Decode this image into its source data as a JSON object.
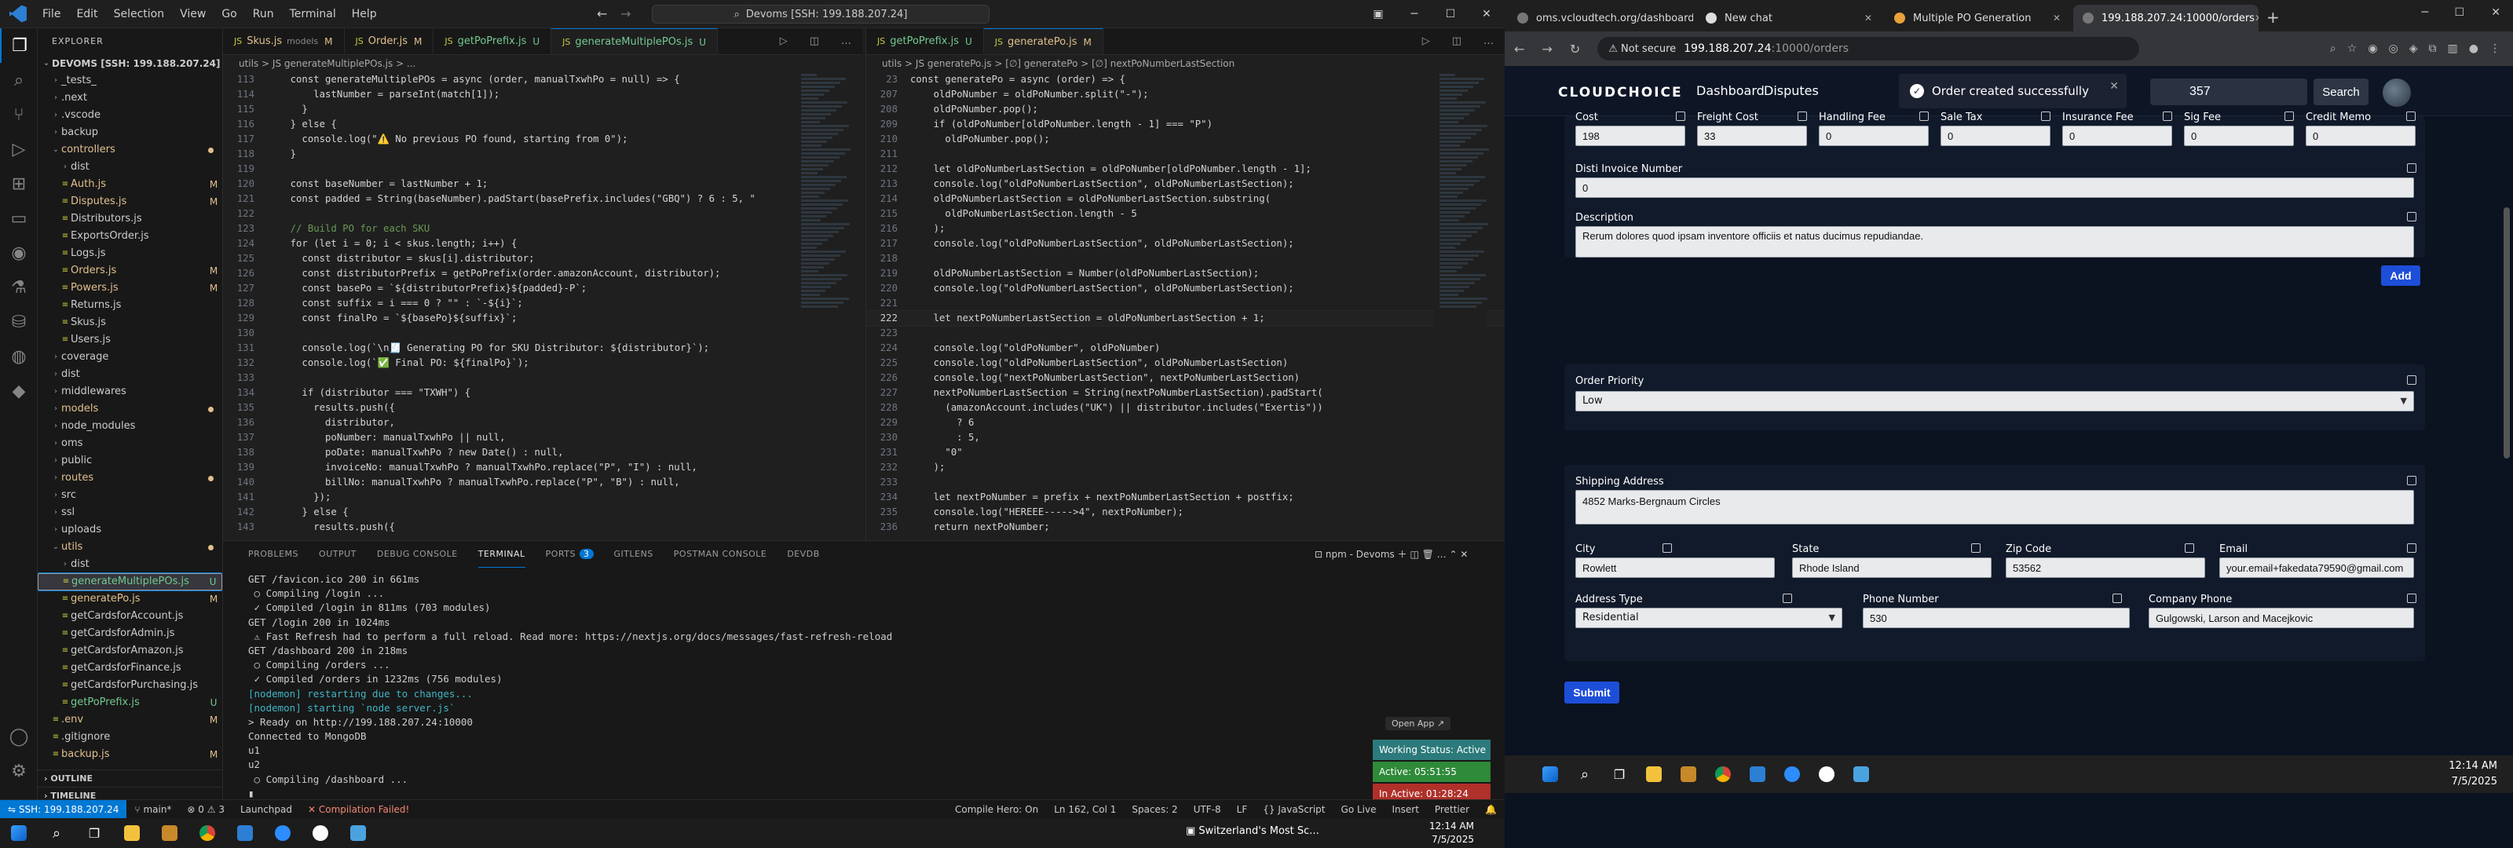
{
  "vscode": {
    "menu": [
      "File",
      "Edit",
      "Selection",
      "View",
      "Go",
      "Run",
      "Terminal",
      "Help"
    ],
    "command_center": "Devoms [SSH: 199.188.207.24]",
    "explorer_title": "EXPLORER",
    "root": "DEVOMS [SSH: 199.188.207.24]",
    "tree": [
      {
        "name": "_tests_",
        "indent": 1,
        "type": "folder",
        "open": false,
        "badge": ""
      },
      {
        "name": ".next",
        "indent": 1,
        "type": "folder",
        "open": false,
        "badge": ""
      },
      {
        "name": ".vscode",
        "indent": 1,
        "type": "folder",
        "open": false,
        "badge": ""
      },
      {
        "name": "backup",
        "indent": 1,
        "type": "folder",
        "open": false,
        "badge": ""
      },
      {
        "name": "controllers",
        "indent": 1,
        "type": "folder",
        "open": true,
        "badge": "",
        "color": "#e2c08d"
      },
      {
        "name": "dist",
        "indent": 2,
        "type": "folder",
        "open": false,
        "badge": ""
      },
      {
        "name": "Auth.js",
        "indent": 2,
        "type": "file",
        "badge": "M",
        "color": "#e2c08d"
      },
      {
        "name": "Disputes.js",
        "indent": 2,
        "type": "file",
        "badge": "M",
        "color": "#e2c08d"
      },
      {
        "name": "Distributors.js",
        "indent": 2,
        "type": "file",
        "badge": ""
      },
      {
        "name": "ExportsOrder.js",
        "indent": 2,
        "type": "file",
        "badge": ""
      },
      {
        "name": "Logs.js",
        "indent": 2,
        "type": "file",
        "badge": ""
      },
      {
        "name": "Orders.js",
        "indent": 2,
        "type": "file",
        "badge": "M",
        "color": "#e2c08d"
      },
      {
        "name": "Powers.js",
        "indent": 2,
        "type": "file",
        "badge": "M",
        "color": "#e2c08d"
      },
      {
        "name": "Returns.js",
        "indent": 2,
        "type": "file",
        "badge": ""
      },
      {
        "name": "Skus.js",
        "indent": 2,
        "type": "file",
        "badge": ""
      },
      {
        "name": "Users.js",
        "indent": 2,
        "type": "file",
        "badge": ""
      },
      {
        "name": "coverage",
        "indent": 1,
        "type": "folder",
        "open": false,
        "badge": ""
      },
      {
        "name": "dist",
        "indent": 1,
        "type": "folder",
        "open": false,
        "badge": ""
      },
      {
        "name": "middlewares",
        "indent": 1,
        "type": "folder",
        "open": false,
        "badge": ""
      },
      {
        "name": "models",
        "indent": 1,
        "type": "folder",
        "open": false,
        "badge": "",
        "color": "#e2c08d"
      },
      {
        "name": "node_modules",
        "indent": 1,
        "type": "folder",
        "open": false,
        "badge": ""
      },
      {
        "name": "oms",
        "indent": 1,
        "type": "folder",
        "open": false,
        "badge": ""
      },
      {
        "name": "public",
        "indent": 1,
        "type": "folder",
        "open": false,
        "badge": ""
      },
      {
        "name": "routes",
        "indent": 1,
        "type": "folder",
        "open": false,
        "badge": "",
        "color": "#e2c08d"
      },
      {
        "name": "src",
        "indent": 1,
        "type": "folder",
        "open": false,
        "badge": ""
      },
      {
        "name": "ssl",
        "indent": 1,
        "type": "folder",
        "open": false,
        "badge": ""
      },
      {
        "name": "uploads",
        "indent": 1,
        "type": "folder",
        "open": false,
        "badge": ""
      },
      {
        "name": "utils",
        "indent": 1,
        "type": "folder",
        "open": true,
        "badge": "",
        "color": "#e2c08d"
      },
      {
        "name": "dist",
        "indent": 2,
        "type": "folder",
        "open": false,
        "badge": ""
      },
      {
        "name": "generateMultiplePOs.js",
        "indent": 2,
        "type": "file",
        "badge": "U",
        "color": "#73c991",
        "selected": true
      },
      {
        "name": "generatePo.js",
        "indent": 2,
        "type": "file",
        "badge": "M",
        "color": "#e2c08d"
      },
      {
        "name": "getCardsforAccount.js",
        "indent": 2,
        "type": "file",
        "badge": ""
      },
      {
        "name": "getCardsforAdmin.js",
        "indent": 2,
        "type": "file",
        "badge": ""
      },
      {
        "name": "getCardsforAmazon.js",
        "indent": 2,
        "type": "file",
        "badge": ""
      },
      {
        "name": "getCardsforFinance.js",
        "indent": 2,
        "type": "file",
        "badge": ""
      },
      {
        "name": "getCardsforPurchasing.js",
        "indent": 2,
        "type": "file",
        "badge": ""
      },
      {
        "name": "getPoPrefix.js",
        "indent": 2,
        "type": "file",
        "badge": "U",
        "color": "#73c991"
      },
      {
        "name": ".env",
        "indent": 1,
        "type": "file",
        "badge": "M",
        "color": "#e2c08d"
      },
      {
        "name": ".gitignore",
        "indent": 1,
        "type": "file",
        "badge": ""
      },
      {
        "name": "backup.js",
        "indent": 1,
        "type": "file",
        "badge": "M",
        "color": "#e2c08d"
      }
    ],
    "outline": "OUTLINE",
    "timeline": "TIMELINE",
    "editor1": {
      "tabs": [
        {
          "label": "Skus.js",
          "sub": "models",
          "mark": "M",
          "active": false
        },
        {
          "label": "Order.js",
          "sub": "",
          "mark": "M",
          "active": false
        },
        {
          "label": "getPoPrefix.js",
          "sub": "",
          "mark": "U",
          "active": false
        },
        {
          "label": "generateMultiplePOs.js",
          "sub": "",
          "mark": "U",
          "active": true
        }
      ],
      "breadcrumb": "utils > JS generateMultiplePOs.js > ...",
      "lines": [
        {
          "n": "113",
          "t": "    const generateMultiplePOs = async (order, manualTxwhPo = null) => {"
        },
        {
          "n": "114",
          "t": "        lastNumber = parseInt(match[1]);"
        },
        {
          "n": "115",
          "t": "      }"
        },
        {
          "n": "116",
          "t": "    } else {"
        },
        {
          "n": "117",
          "t": "      console.log(\"⚠️ No previous PO found, starting from 0\");"
        },
        {
          "n": "118",
          "t": "    }"
        },
        {
          "n": "119",
          "t": ""
        },
        {
          "n": "120",
          "t": "    const baseNumber = lastNumber + 1;"
        },
        {
          "n": "121",
          "t": "    const padded = String(baseNumber).padStart(basePrefix.includes(\"GBQ\") ? 6 : 5, \""
        },
        {
          "n": "122",
          "t": ""
        },
        {
          "n": "123",
          "t": "    // Build PO for each SKU"
        },
        {
          "n": "124",
          "t": "    for (let i = 0; i < skus.length; i++) {"
        },
        {
          "n": "125",
          "t": "      const distributor = skus[i].distributor;"
        },
        {
          "n": "126",
          "t": "      const distributorPrefix = getPoPrefix(order.amazonAccount, distributor);"
        },
        {
          "n": "127",
          "t": "      const basePo = `${distributorPrefix}${padded}-P`;"
        },
        {
          "n": "128",
          "t": "      const suffix = i === 0 ? \"\" : `-${i}`;"
        },
        {
          "n": "129",
          "t": "      const finalPo = `${basePo}${suffix}`;"
        },
        {
          "n": "130",
          "t": ""
        },
        {
          "n": "131",
          "t": "      console.log(`\\n🧾 Generating PO for SKU Distributor: ${distributor}`);"
        },
        {
          "n": "132",
          "t": "      console.log(`✅ Final PO: ${finalPo}`);"
        },
        {
          "n": "133",
          "t": ""
        },
        {
          "n": "134",
          "t": "      if (distributor === \"TXWH\") {"
        },
        {
          "n": "135",
          "t": "        results.push({"
        },
        {
          "n": "136",
          "t": "          distributor,"
        },
        {
          "n": "137",
          "t": "          poNumber: manualTxwhPo || null,"
        },
        {
          "n": "138",
          "t": "          poDate: manualTxwhPo ? new Date() : null,"
        },
        {
          "n": "139",
          "t": "          invoiceNo: manualTxwhPo ? manualTxwhPo.replace(\"P\", \"I\") : null,"
        },
        {
          "n": "140",
          "t": "          billNo: manualTxwhPo ? manualTxwhPo.replace(\"P\", \"B\") : null,"
        },
        {
          "n": "141",
          "t": "        });"
        },
        {
          "n": "142",
          "t": "      } else {"
        },
        {
          "n": "143",
          "t": "        results.push({"
        }
      ]
    },
    "editor2": {
      "tabs": [
        {
          "label": "getPoPrefix.js",
          "sub": "",
          "mark": "U",
          "active": false
        },
        {
          "label": "generatePo.js",
          "sub": "",
          "mark": "M",
          "active": true
        }
      ],
      "breadcrumb": "utils > JS generatePo.js > [∅] generatePo > [∅] nextPoNumberLastSection",
      "current_line": "222",
      "lines": [
        {
          "n": "23",
          "t": "const generatePo = async (order) => {"
        },
        {
          "n": "207",
          "t": "    oldPoNumber = oldPoNumber.split(\"-\");"
        },
        {
          "n": "208",
          "t": "    oldPoNumber.pop();"
        },
        {
          "n": "209",
          "t": "    if (oldPoNumber[oldPoNumber.length - 1] === \"P\")"
        },
        {
          "n": "210",
          "t": "      oldPoNumber.pop();"
        },
        {
          "n": "211",
          "t": ""
        },
        {
          "n": "212",
          "t": "    let oldPoNumberLastSection = oldPoNumber[oldPoNumber.length - 1];"
        },
        {
          "n": "213",
          "t": "    console.log(\"oldPoNumberLastSection\", oldPoNumberLastSection);"
        },
        {
          "n": "214",
          "t": "    oldPoNumberLastSection = oldPoNumberLastSection.substring("
        },
        {
          "n": "215",
          "t": "      oldPoNumberLastSection.length - 5"
        },
        {
          "n": "216",
          "t": "    );"
        },
        {
          "n": "217",
          "t": "    console.log(\"oldPoNumberLastSection\", oldPoNumberLastSection);"
        },
        {
          "n": "218",
          "t": ""
        },
        {
          "n": "219",
          "t": "    oldPoNumberLastSection = Number(oldPoNumberLastSection);"
        },
        {
          "n": "220",
          "t": "    console.log(\"oldPoNumberLastSection\", oldPoNumberLastSection);"
        },
        {
          "n": "221",
          "t": ""
        },
        {
          "n": "222",
          "t": "    let nextPoNumberLastSection = oldPoNumberLastSection + 1;"
        },
        {
          "n": "223",
          "t": ""
        },
        {
          "n": "224",
          "t": "    console.log(\"oldPoNumber\", oldPoNumber)"
        },
        {
          "n": "225",
          "t": "    console.log(\"oldPoNumberLastSection\", oldPoNumberLastSection)"
        },
        {
          "n": "226",
          "t": "    console.log(\"nextPoNumberLastSection\", nextPoNumberLastSection)"
        },
        {
          "n": "227",
          "t": "    nextPoNumberLastSection = String(nextPoNumberLastSection).padStart("
        },
        {
          "n": "228",
          "t": "      (amazonAccount.includes(\"UK\") || distributor.includes(\"Exertis\"))"
        },
        {
          "n": "229",
          "t": "        ? 6"
        },
        {
          "n": "230",
          "t": "        : 5,"
        },
        {
          "n": "231",
          "t": "      \"0\""
        },
        {
          "n": "232",
          "t": "    );"
        },
        {
          "n": "233",
          "t": ""
        },
        {
          "n": "234",
          "t": "    let nextPoNumber = prefix + nextPoNumberLastSection + postfix;"
        },
        {
          "n": "235",
          "t": "    console.log(\"HEREEE----->4\", nextPoNumber);"
        },
        {
          "n": "236",
          "t": "    return nextPoNumber;"
        }
      ]
    },
    "panel": {
      "tabs": [
        "PROBLEMS",
        "OUTPUT",
        "DEBUG CONSOLE",
        "TERMINAL",
        "PORTS",
        "GITLENS",
        "POSTMAN CONSOLE",
        "DEVDB"
      ],
      "active_tab": "TERMINAL",
      "ports_badge": "3",
      "terminal_name": "npm - Devoms",
      "lines": [
        "GET /favicon.ico 200 in 661ms",
        " ○ Compiling /login ...",
        " ✓ Compiled /login in 811ms (703 modules)",
        "GET /login 200 in 1024ms",
        " ⚠ Fast Refresh had to perform a full reload. Read more: https://nextjs.org/docs/messages/fast-refresh-reload",
        "GET /dashboard 200 in 218ms",
        " ○ Compiling /orders ...",
        " ✓ Compiled /orders in 1232ms (756 modules)",
        "[nodemon] restarting due to changes...",
        "[nodemon] starting `node server.js`",
        "> Ready on http://199.188.207.24:10000",
        "Connected to MongoDB",
        "u1",
        "u2",
        " ○ Compiling /dashboard ..."
      ],
      "open_app": "Open App ↗",
      "working_status": "Working Status: Active",
      "active_time": "Active: 05:51:55",
      "inactive_time": "In Active: 01:28:24"
    },
    "statusbar": {
      "remote": "SSH: 199.188.207.24",
      "branch": "main*",
      "errors": "⊗ 0  ⚠ 3",
      "launchpad": "Launchpad",
      "compile": "✕ Compilation Failed!",
      "compile_hero": "Compile Hero: On",
      "position": "Ln 162, Col 1",
      "spaces": "Spaces: 2",
      "encoding": "UTF-8",
      "eol": "LF",
      "language": "{} JavaScript",
      "golive": "Go Live",
      "insert": "Insert",
      "prettier": "Prettier"
    },
    "taskbar": {
      "weather": "Switzerland's Most Sc...",
      "time": "12:14 AM",
      "date": "7/5/2025"
    }
  },
  "browser": {
    "tabs": [
      {
        "label": "oms.vcloudtech.org/dashboard",
        "active": false
      },
      {
        "label": "New chat",
        "active": false
      },
      {
        "label": "Multiple PO Generation",
        "active": false
      },
      {
        "label": "199.188.207.24:10000/orders",
        "active": true
      }
    ],
    "not_secure": "Not secure",
    "url_host": "199.188.207.24",
    "url_path": ":10000/orders",
    "app": {
      "brand": "CLOUDCHOICE",
      "nav": [
        "Dashboard",
        "Disputes"
      ],
      "search_value": "357",
      "search_button": "Search",
      "toast": "Order created successfully",
      "costs": [
        {
          "label": "Cost",
          "value": "198"
        },
        {
          "label": "Freight Cost",
          "value": "33"
        },
        {
          "label": "Handling Fee",
          "value": "0"
        },
        {
          "label": "Sale Tax",
          "value": "0"
        },
        {
          "label": "Insurance Fee",
          "value": "0"
        },
        {
          "label": "Sig Fee",
          "value": "0"
        },
        {
          "label": "Credit Memo",
          "value": "0"
        }
      ],
      "disti_invoice_label": "Disti Invoice Number",
      "disti_invoice_value": "0",
      "description_label": "Description",
      "description_value": "Rerum dolores quod ipsam inventore officiis et natus ducimus repudiandae.",
      "add_button": "Add",
      "order_priority_label": "Order Priority",
      "order_priority_value": "Low",
      "shipping_label": "Shipping Address",
      "shipping_value": "4852 Marks-Bergnaum Circles",
      "city_label": "City",
      "city_value": "Rowlett",
      "state_label": "State",
      "state_value": "Rhode Island",
      "zip_label": "Zip Code",
      "zip_value": "53562",
      "email_label": "Email",
      "email_value": "your.email+fakedata79590@gmail.com",
      "address_type_label": "Address Type",
      "address_type_value": "Residential",
      "phone_label": "Phone Number",
      "phone_value": "530",
      "company_phone_label": "Company Phone",
      "company_phone_value": "Gulgowski, Larson and Macejkovic",
      "submit": "Submit"
    },
    "taskbar": {
      "time": "12:14 AM",
      "date": "7/5/2025"
    }
  }
}
